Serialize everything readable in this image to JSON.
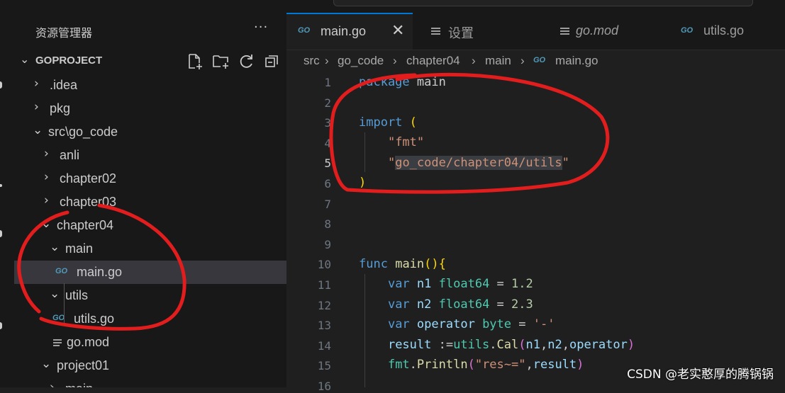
{
  "sidebar": {
    "title": "资源管理器",
    "more_label": "···",
    "project": "GOPROJECT",
    "tree": [
      {
        "chev": "›",
        "label": ".idea",
        "kind": "folder"
      },
      {
        "chev": "›",
        "label": "pkg",
        "kind": "folder"
      },
      {
        "chev": "⌄",
        "label": "src\\go_code",
        "kind": "folder"
      },
      {
        "chev": "›",
        "label": "anli",
        "kind": "folder"
      },
      {
        "chev": "›",
        "label": "chapter02",
        "kind": "folder"
      },
      {
        "chev": "›",
        "label": "chapter03",
        "kind": "folder"
      },
      {
        "chev": "⌄",
        "label": "chapter04",
        "kind": "folder"
      },
      {
        "chev": "⌄",
        "label": "main",
        "kind": "folder"
      },
      {
        "chev": "",
        "label": "main.go",
        "kind": "go"
      },
      {
        "chev": "⌄",
        "label": "utils",
        "kind": "folder"
      },
      {
        "chev": "",
        "label": "utils.go",
        "kind": "go"
      },
      {
        "chev": "",
        "label": "go.mod",
        "kind": "mod"
      },
      {
        "chev": "⌄",
        "label": "project01",
        "kind": "folder"
      },
      {
        "chev": "›",
        "label": "main",
        "kind": "folder"
      }
    ]
  },
  "tabs": [
    {
      "label": "main.go",
      "icon": "go-icon",
      "active": true,
      "close": "✕"
    },
    {
      "label": "设置",
      "icon": "lines-icon",
      "active": false
    },
    {
      "label": "go.mod",
      "icon": "lines-icon",
      "active": false,
      "italic": true
    },
    {
      "label": "utils.go",
      "icon": "go-icon",
      "active": false
    }
  ],
  "breadcrumb": {
    "sep": "›",
    "parts": [
      "src",
      "go_code",
      "chapter04",
      "main"
    ],
    "file": "main.go"
  },
  "go_icon_text": "GO",
  "code": {
    "line_numbers": [
      "1",
      "2",
      "3",
      "4",
      "5",
      "6",
      "7",
      "8",
      "9",
      "10",
      "11",
      "12",
      "13",
      "14",
      "15",
      "16"
    ],
    "current_line": 5
  },
  "watermark": "CSDN @老实憨厚的腾锅锅",
  "colors": {
    "accent": "#0078d4",
    "annotation": "#e11d1d",
    "keyword": "#569cd6",
    "string": "#ce9178",
    "function": "#dcdcaa",
    "type": "#4ec9b0",
    "number": "#b5cea8"
  }
}
